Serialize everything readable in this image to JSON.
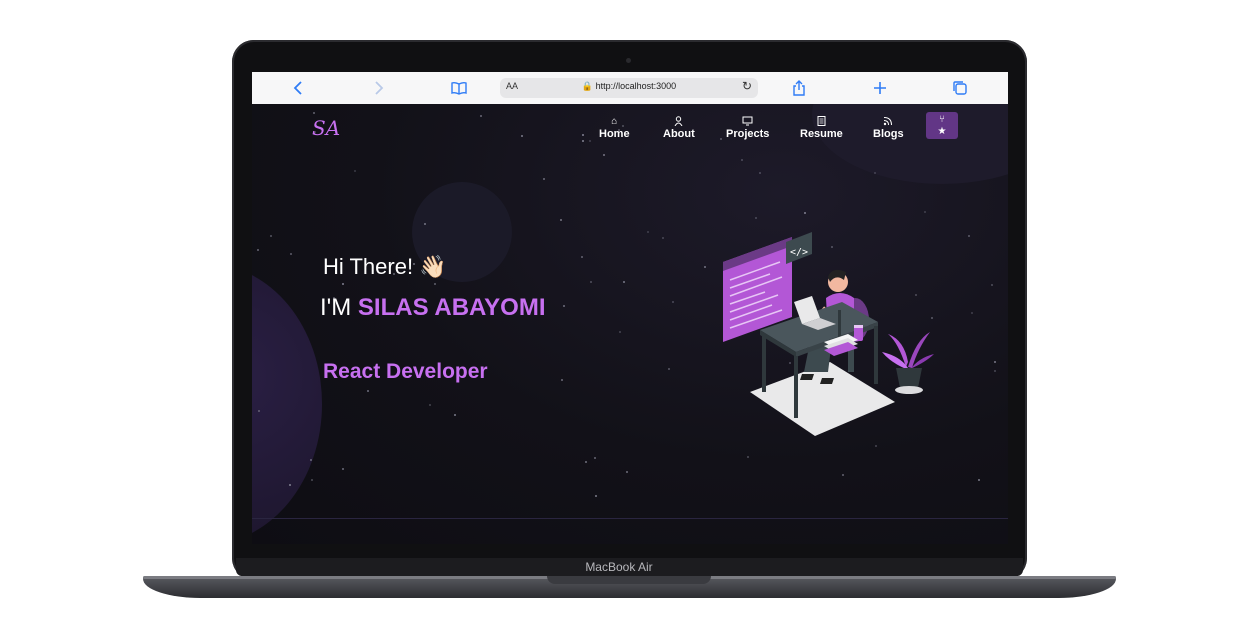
{
  "device": {
    "label": "MacBook Air"
  },
  "browser": {
    "back_icon": "chevron-left-icon",
    "forward_icon": "chevron-right-icon",
    "bookmarks_icon": "book-icon",
    "reader_label": "AA",
    "url": "http://localhost:3000",
    "share_icon": "share-icon",
    "new_tab_icon": "plus-icon",
    "tabs_icon": "tabs-icon"
  },
  "site": {
    "logo": "SA",
    "nav": [
      {
        "label": "Home",
        "icon": "home-icon"
      },
      {
        "label": "About",
        "icon": "user-icon"
      },
      {
        "label": "Projects",
        "icon": "monitor-icon"
      },
      {
        "label": "Resume",
        "icon": "document-icon"
      },
      {
        "label": "Blogs",
        "icon": "rss-icon"
      }
    ],
    "github_button": {
      "icon": "fork-star-icon"
    }
  },
  "hero": {
    "greeting": "Hi There! 👋🏻",
    "intro_prefix": "I'M",
    "name": "SILAS ABAYOMI",
    "role": "React Developer"
  },
  "colors": {
    "accent": "#c770f0",
    "button": "#623686",
    "background": "#121118"
  }
}
